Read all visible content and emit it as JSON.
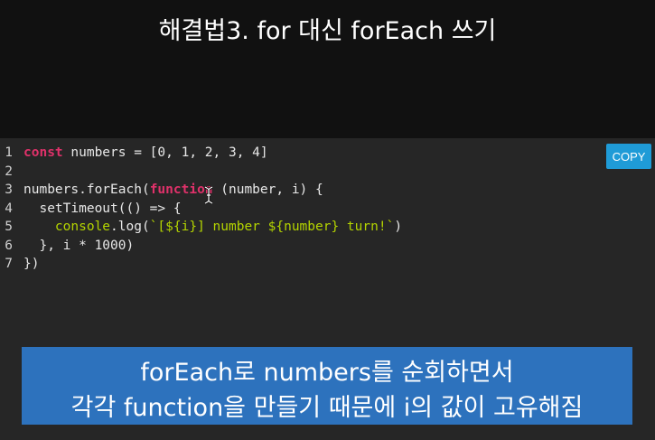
{
  "title": "해결법3. for 대신 forEach 쓰기",
  "copy_label": "COPY",
  "code": {
    "l1": {
      "n": "1",
      "kw": "const",
      "rest": " numbers = [0, 1, 2, 3, 4]"
    },
    "l2": {
      "n": "2"
    },
    "l3": {
      "n": "3",
      "pre": "numbers.forEach(",
      "kw": "function",
      "rest": " (number, i) {"
    },
    "l4": {
      "n": "4",
      "text": "  setTimeout(() => {"
    },
    "l5": {
      "n": "5",
      "pre": "    ",
      "fn": "console",
      "mid": ".log(",
      "str": "`[${i}] number ${number} turn!`",
      "rest": ")"
    },
    "l6": {
      "n": "6",
      "text": "  }, i * 1000)"
    },
    "l7": {
      "n": "7",
      "text": "})"
    }
  },
  "subtitle": {
    "line1": "forEach로 numbers를 순회하면서",
    "line2": "각각 function을 만들기 때문에 i의 값이 고유해짐"
  },
  "colors": {
    "keyword": "#e0316a",
    "string": "#b4d400",
    "copy_button": "#1f9bd7",
    "subtitle_bg": "#2d72bd"
  }
}
